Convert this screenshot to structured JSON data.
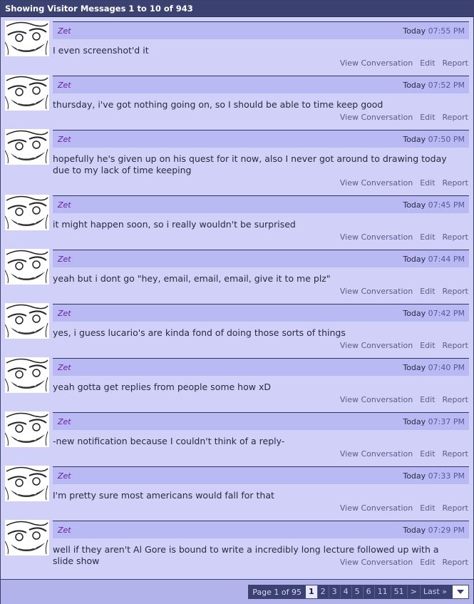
{
  "header": {
    "title": "Showing Visitor Messages 1 to 10 of 943"
  },
  "actions": {
    "view": "View Conversation",
    "edit": "Edit",
    "report": "Report"
  },
  "messages": [
    {
      "user": "Zet",
      "day": "Today",
      "time": "07:55 PM",
      "text": "I even screenshot'd it"
    },
    {
      "user": "Zet",
      "day": "Today",
      "time": "07:52 PM",
      "text": "thursday, i've got nothing going on, so I should be able to time keep good"
    },
    {
      "user": "Zet",
      "day": "Today",
      "time": "07:50 PM",
      "text": "hopefully he's given up on his quest for it now, also I never got around to drawing today due to my lack of time keeping"
    },
    {
      "user": "Zet",
      "day": "Today",
      "time": "07:45 PM",
      "text": "it might happen soon, so i really wouldn't be surprised"
    },
    {
      "user": "Zet",
      "day": "Today",
      "time": "07:44 PM",
      "text": "yeah but i dont go \"hey, email, email, email, give it to me plz\""
    },
    {
      "user": "Zet",
      "day": "Today",
      "time": "07:42 PM",
      "text": "yes, i guess lucario's are kinda fond of doing those sorts of things"
    },
    {
      "user": "Zet",
      "day": "Today",
      "time": "07:40 PM",
      "text": "yeah gotta get replies from people some how xD"
    },
    {
      "user": "Zet",
      "day": "Today",
      "time": "07:37 PM",
      "text": "-new notification because I couldn't think of a reply-"
    },
    {
      "user": "Zet",
      "day": "Today",
      "time": "07:33 PM",
      "text": "I'm pretty sure most americans would fall for that"
    },
    {
      "user": "Zet",
      "day": "Today",
      "time": "07:29 PM",
      "text": "well if they aren't Al Gore is bound to write a incredibly long lecture followed up with a slide show"
    }
  ],
  "pager": {
    "info": "Page 1 of 95",
    "pages": [
      "1",
      "2",
      "3",
      "4",
      "5",
      "6",
      "11",
      "51"
    ],
    "next": ">",
    "last": "Last »"
  }
}
